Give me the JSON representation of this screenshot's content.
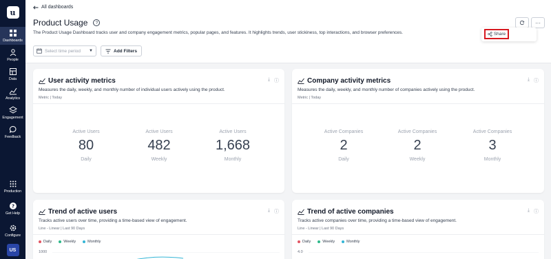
{
  "sidebar": {
    "logo": "u",
    "items": [
      {
        "label": "Dashboards",
        "icon": "dashboards-grid-icon",
        "active": true
      },
      {
        "label": "People",
        "icon": "people-icon"
      },
      {
        "label": "Data",
        "icon": "data-icon"
      },
      {
        "label": "Analytics",
        "icon": "analytics-icon"
      },
      {
        "label": "Engagement",
        "icon": "engagement-icon"
      },
      {
        "label": "Feedback",
        "icon": "feedback-icon"
      }
    ],
    "bottom_items": [
      {
        "label": "Production",
        "icon": "production-grid-icon"
      },
      {
        "label": "Get Help",
        "icon": "help-icon"
      },
      {
        "label": "Configure",
        "icon": "gear-icon"
      }
    ],
    "avatar": "US"
  },
  "header": {
    "back_label": "All dashboards",
    "title": "Product Usage",
    "help_symbol": "?",
    "description": "The Product Usage Dashboard tracks user and company engagement metrics, popular pages, and features. It highlights trends, user stickiness, top interactions, and browser preferences.",
    "share_label": "Share",
    "more_label": "···"
  },
  "filters": {
    "time_placeholder": "Select time period",
    "add_filters_label": "Add Filters"
  },
  "cards": {
    "user_activity": {
      "title": "User activity metrics",
      "description": "Measures the daily, weekly, and monthly number of individual users actively using the product.",
      "meta": "Metric | Today",
      "metrics": [
        {
          "label": "Active Users",
          "value": "80",
          "period": "Daily"
        },
        {
          "label": "Active Users",
          "value": "482",
          "period": "Weekly"
        },
        {
          "label": "Active Users",
          "value": "1,668",
          "period": "Monthly"
        }
      ]
    },
    "company_activity": {
      "title": "Company activity metrics",
      "description": "Measures the daily, weekly, and monthly number of companies actively using the product.",
      "meta": "Metric | Today",
      "metrics": [
        {
          "label": "Active Companies",
          "value": "2",
          "period": "Daily"
        },
        {
          "label": "Active Companies",
          "value": "2",
          "period": "Weekly"
        },
        {
          "label": "Active Companies",
          "value": "3",
          "period": "Monthly"
        }
      ]
    },
    "trend_users": {
      "title": "Trend of active users",
      "description": "Tracks active users over time, providing a time-based view of engagement.",
      "meta": "Line - Linear | Last 90 Days",
      "legend": [
        {
          "label": "Daily",
          "color": "#e25563"
        },
        {
          "label": "Weekly",
          "color": "#2eb88a"
        },
        {
          "label": "Monthly",
          "color": "#33b5d6"
        }
      ],
      "ytick_top": "1000"
    },
    "trend_companies": {
      "title": "Trend of active companies",
      "description": "Tracks active companies over time, providing a time-based view of engagement.",
      "meta": "Line - Linear | Last 90 Days",
      "legend": [
        {
          "label": "Daily",
          "color": "#e25563"
        },
        {
          "label": "Weekly",
          "color": "#2eb88a"
        },
        {
          "label": "Monthly",
          "color": "#33b5d6"
        }
      ],
      "ytick_top": "4.0"
    }
  },
  "colors": {
    "sidebar_bg": "#0b1733",
    "highlight_border": "#d71920"
  }
}
